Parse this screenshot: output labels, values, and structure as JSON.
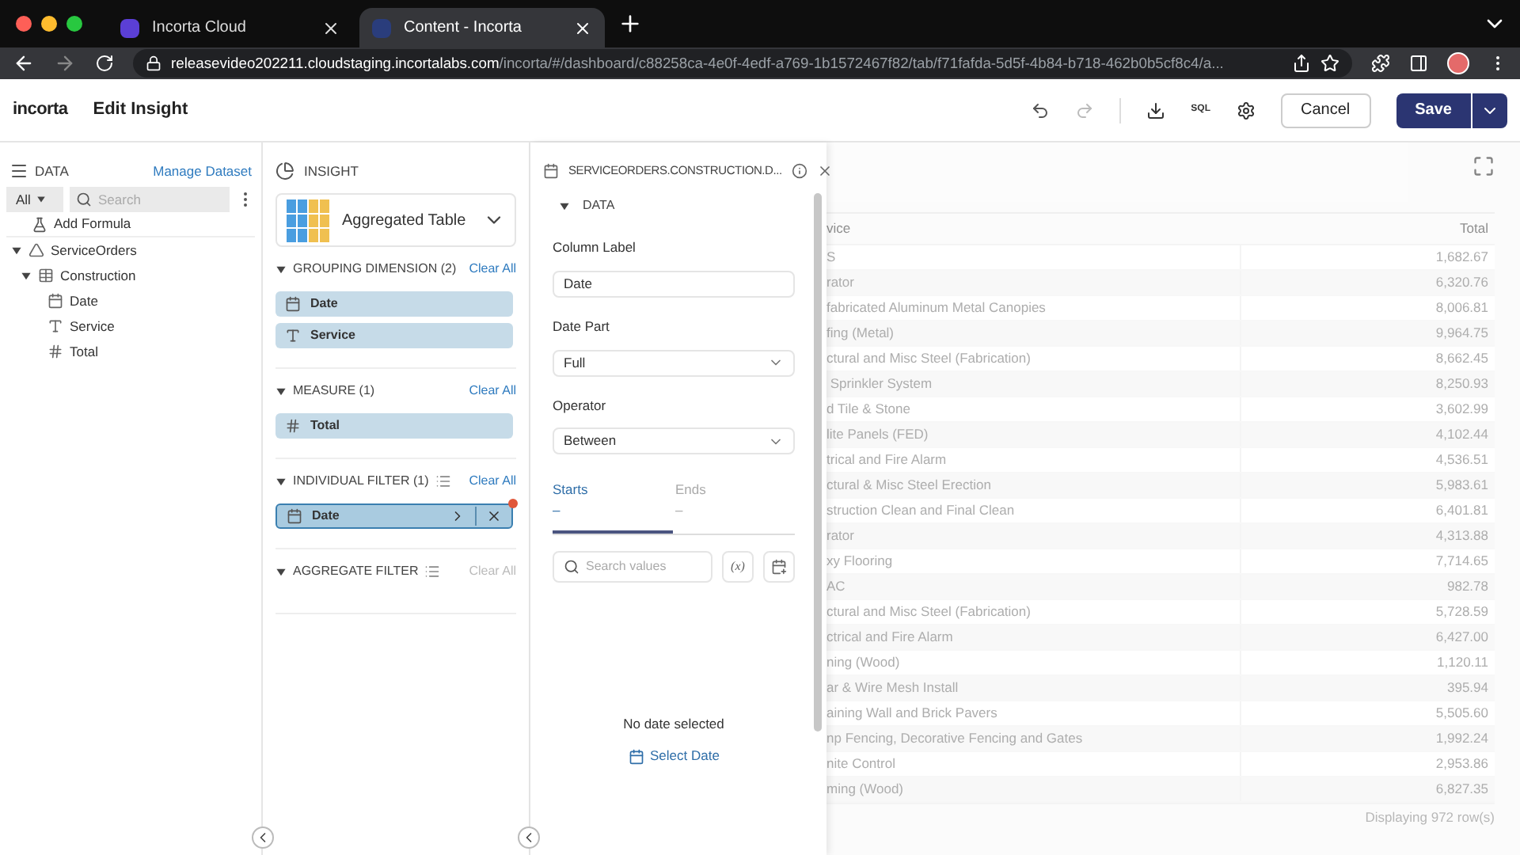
{
  "browser": {
    "tabs": [
      {
        "title": "Incorta Cloud",
        "selected": false
      },
      {
        "title": "Content - Incorta",
        "selected": true
      }
    ],
    "url": {
      "host": "releasevideo202211.cloudstaging.incortalabs.com",
      "path": "/incorta/#/dashboard/c88258ca-4e0f-4edf-a769-1b1572467f82/tab/f71fafda-5d5f-4b84-b718-462b0b5cf8c4/a..."
    }
  },
  "header": {
    "logo": "incorta",
    "title": "Edit Insight",
    "sql": "SQL",
    "cancel": "Cancel",
    "save": "Save"
  },
  "data_panel": {
    "title": "DATA",
    "manage": "Manage Dataset",
    "scope": "All",
    "search_placeholder": "Search",
    "add_formula": "Add Formula",
    "tree": [
      {
        "label": "ServiceOrders",
        "kind": "schema",
        "expanded": true,
        "children": [
          {
            "label": "Construction",
            "kind": "table",
            "expanded": true,
            "children": [
              {
                "label": "Date",
                "kind": "date"
              },
              {
                "label": "Service",
                "kind": "text"
              },
              {
                "label": "Total",
                "kind": "number"
              }
            ]
          }
        ]
      }
    ]
  },
  "insight_panel": {
    "title": "INSIGHT",
    "viz": "Aggregated Table",
    "sections": [
      {
        "title": "GROUPING DIMENSION (2)",
        "clear": "Clear All",
        "clear_enabled": true,
        "list_icon": false,
        "pills": [
          {
            "label": "Date",
            "kind": "date",
            "selected": false
          },
          {
            "label": "Service",
            "kind": "text",
            "selected": false
          }
        ]
      },
      {
        "title": "MEASURE (1)",
        "clear": "Clear All",
        "clear_enabled": true,
        "list_icon": false,
        "pills": [
          {
            "label": "Total",
            "kind": "number",
            "selected": false
          }
        ]
      },
      {
        "title": "INDIVIDUAL FILTER (1)",
        "clear": "Clear All",
        "clear_enabled": true,
        "list_icon": true,
        "pills": [
          {
            "label": "Date",
            "kind": "date",
            "selected": true
          }
        ]
      },
      {
        "title": "AGGREGATE FILTER",
        "clear": "Clear All",
        "clear_enabled": false,
        "list_icon": true
      }
    ]
  },
  "filter_panel": {
    "title": "SERVICEORDERS.CONSTRUCTION.D...",
    "section": "DATA",
    "fields": [
      {
        "label": "Column Label",
        "value": "Date",
        "kind": "input"
      },
      {
        "label": "Date Part",
        "value": "Full",
        "kind": "select"
      },
      {
        "label": "Operator",
        "value": "Between",
        "kind": "select"
      }
    ],
    "tabs": [
      {
        "label": "Starts",
        "value": "–",
        "selected": true
      },
      {
        "label": "Ends",
        "value": "–",
        "selected": false
      }
    ],
    "search_placeholder": "Search values",
    "variable": "(x)",
    "empty": "No date selected",
    "select_date": "Select Date"
  },
  "table": {
    "columns": [
      "vice",
      "Total"
    ],
    "rows": [
      [
        "S",
        "1,682.67"
      ],
      [
        "rator",
        "6,320.76"
      ],
      [
        "fabricated Aluminum Metal Canopies",
        "8,006.81"
      ],
      [
        "fing (Metal)",
        "9,964.75"
      ],
      [
        "ctural and Misc Steel (Fabrication)",
        "8,662.45"
      ],
      [
        " Sprinkler System",
        "8,250.93"
      ],
      [
        "d Tile & Stone",
        "3,602.99"
      ],
      [
        "lite Panels (FED)",
        "4,102.44"
      ],
      [
        "trical and Fire Alarm",
        "4,536.51"
      ],
      [
        "ctural & Misc Steel Erection",
        "5,983.61"
      ],
      [
        "struction Clean and Final Clean",
        "6,401.81"
      ],
      [
        "rator",
        "4,313.88"
      ],
      [
        "xy Flooring",
        "7,714.65"
      ],
      [
        "AC",
        "982.78"
      ],
      [
        "ctural and Misc Steel (Fabrication)",
        "5,728.59"
      ],
      [
        "ctrical and Fire Alarm",
        "6,427.00"
      ],
      [
        "ning (Wood)",
        "1,120.11"
      ],
      [
        "ar & Wire Mesh Install",
        "395.94"
      ],
      [
        "aining Wall and Brick Pavers",
        "5,505.60"
      ],
      [
        "np Fencing, Decorative Fencing and Gates",
        "1,992.24"
      ],
      [
        "nite Control",
        "2,953.86"
      ],
      [
        "ming (Wood)",
        "6,827.35"
      ]
    ],
    "footer": "Displaying 972 row(s)"
  }
}
